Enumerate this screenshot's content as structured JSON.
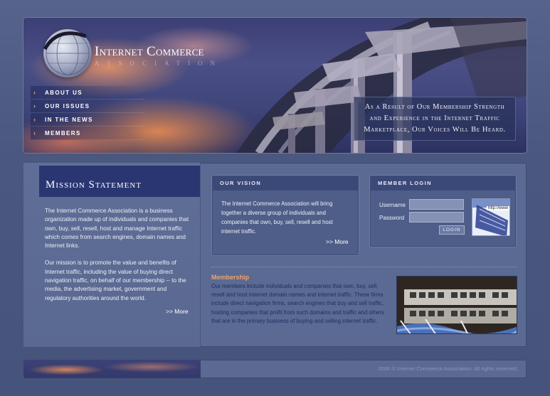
{
  "header": {
    "logo_title": "Internet Commerce",
    "logo_sub": "ASSOCIATION",
    "slogan_line1": "As a Result of Our Membership Strength",
    "slogan_line2": "and Experience in the Internet Traffic",
    "slogan_line3": "Marketplace, Our Voices Will Be Heard."
  },
  "nav": {
    "items": [
      {
        "label": "ABOUT US"
      },
      {
        "label": "OUR ISSUES"
      },
      {
        "label": "IN THE NEWS"
      },
      {
        "label": "MEMBERS"
      }
    ]
  },
  "mission": {
    "title": "Mission Statement",
    "para1": "The Internet Commerce Association is a business organization made up of individuals and companies that own, buy, sell, resell, host and manage Internet traffic which comes from search engines, domain names and Internet links.",
    "para2": "Our mission is to promote the value and benefits of Internet traffic, including the value of buying direct navigation traffic, on behalf of our membership -- to the media, the advertising market, government and regulatory authorities around the world.",
    "more": ">> More"
  },
  "vision": {
    "title": "OUR VISION",
    "text": "The Internet Commerce Association will bring together a diverse group of individuals and companies that own, buy, sell, resell and host internet traffic.",
    "more": ">> More"
  },
  "login": {
    "title": "MEMBER LOGIN",
    "username_label": "Username",
    "password_label": "Password",
    "username_value": "",
    "password_value": "",
    "button": "LOGIN",
    "thumb_text": "http://www"
  },
  "membership": {
    "title": "Membership",
    "text": "Our members include individuals and companies that own, buy, sell, resell and host internet domain names and internet traffic. These firms include direct navigation firms, search engines that buy and sell traffic, hosting companies that profit from such domains and traffic and others that are in the primary business of buying and selling internet traffic."
  },
  "footer": {
    "copyright": "2006 © Internet Commerce Association. All rights reserved."
  },
  "colors": {
    "background": "#4a5a82",
    "accent_orange": "#f4a26a",
    "header_blue": "#2a3672"
  }
}
